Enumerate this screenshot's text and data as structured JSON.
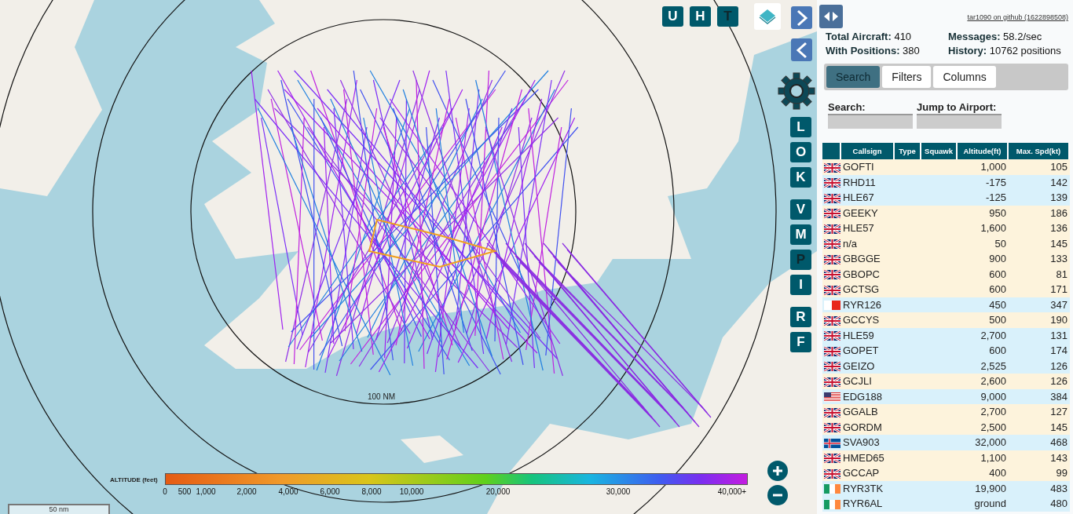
{
  "map": {
    "range_label": "100 NM",
    "scale_label": "50 nm",
    "top_buttons": [
      {
        "label": "U",
        "active": true
      },
      {
        "label": "H",
        "active": true
      },
      {
        "label": "T",
        "active": false
      }
    ],
    "side_buttons": [
      {
        "label": "L",
        "active": true
      },
      {
        "label": "O",
        "active": true
      },
      {
        "label": "K",
        "active": true
      },
      {
        "label": "V",
        "active": true
      },
      {
        "label": "M",
        "active": true
      },
      {
        "label": "P",
        "active": false
      },
      {
        "label": "I",
        "active": true
      },
      {
        "label": "R",
        "active": true
      },
      {
        "label": "F",
        "active": true
      }
    ],
    "legend": {
      "title": "ALTITUDE (feet)",
      "ticks": [
        "0",
        "500",
        "1,000",
        "2,000",
        "4,000",
        "6,000",
        "8,000",
        "10,000",
        "20,000",
        "30,000",
        "40,000+"
      ]
    }
  },
  "panel": {
    "link": "tar1090 on github (1622898508)",
    "stats": [
      "**Total Aircraft:** 410",
      "**Messages:** 58.2/sec",
      "**With Positions:** 380",
      "**History:** 10762 positions"
    ],
    "tabs": [
      {
        "label": "Search",
        "selected": true
      },
      {
        "label": "Filters",
        "selected": false
      },
      {
        "label": "Columns",
        "selected": false
      }
    ],
    "fields": [
      {
        "label": "Search:"
      },
      {
        "label": "Jump to Airport:"
      }
    ],
    "table": {
      "columns": [
        "Callsign",
        "Type",
        "Squawk",
        "Altitude(ft)",
        "Max. Spd(kt)"
      ],
      "rows": [
        {
          "kind": "uk",
          "callsign": "GOFTI",
          "altitude": "1,000",
          "speed": "105",
          "color": "#fdf3dc"
        },
        {
          "kind": "uk",
          "callsign": "RHD11",
          "altitude": "-175",
          "speed": "142",
          "color": "#d9f1fb"
        },
        {
          "kind": "uk",
          "callsign": "HLE67",
          "altitude": "-125",
          "speed": "139",
          "color": "#d9f1fb"
        },
        {
          "kind": "uk",
          "callsign": "GEEKY",
          "altitude": "950",
          "speed": "186",
          "color": "#fdf3dc"
        },
        {
          "kind": "uk",
          "callsign": "HLE57",
          "altitude": "1,600",
          "speed": "136",
          "color": "#fdf3dc"
        },
        {
          "kind": "uk",
          "callsign": "n/a",
          "altitude": "50",
          "speed": "145",
          "color": "#fdf3dc"
        },
        {
          "kind": "uk",
          "callsign": "GBGGE",
          "altitude": "900",
          "speed": "133",
          "color": "#fdf3dc"
        },
        {
          "kind": "uk",
          "callsign": "GBOPC",
          "altitude": "600",
          "speed": "81",
          "color": "#fdf3dc"
        },
        {
          "kind": "uk",
          "callsign": "GCTSG",
          "altitude": "600",
          "speed": "171",
          "color": "#fdf3dc"
        },
        {
          "kind": "malta",
          "callsign": "RYR126",
          "altitude": "450",
          "speed": "347",
          "color": "#d9f1fb"
        },
        {
          "kind": "uk",
          "callsign": "GCCYS",
          "altitude": "500",
          "speed": "190",
          "color": "#fdf3dc"
        },
        {
          "kind": "uk",
          "callsign": "HLE59",
          "altitude": "2,700",
          "speed": "131",
          "color": "#d9f1fb"
        },
        {
          "kind": "uk",
          "callsign": "GOPET",
          "altitude": "600",
          "speed": "174",
          "color": "#d9f1fb"
        },
        {
          "kind": "uk",
          "callsign": "GEIZO",
          "altitude": "2,525",
          "speed": "126",
          "color": "#d9f1fb"
        },
        {
          "kind": "uk",
          "callsign": "GCJLI",
          "altitude": "2,600",
          "speed": "126",
          "color": "#fdf3dc"
        },
        {
          "kind": "usa",
          "callsign": "EDG188",
          "altitude": "9,000",
          "speed": "384",
          "color": "#d9f1fb"
        },
        {
          "kind": "uk",
          "callsign": "GGALB",
          "altitude": "2,700",
          "speed": "127",
          "color": "#fdf3dc"
        },
        {
          "kind": "uk",
          "callsign": "GORDM",
          "altitude": "2,500",
          "speed": "145",
          "color": "#fdf3dc"
        },
        {
          "kind": "iceland",
          "callsign": "SVA903",
          "altitude": "32,000",
          "speed": "468",
          "color": "#d9f1fb"
        },
        {
          "kind": "uk",
          "callsign": "HMED65",
          "altitude": "1,100",
          "speed": "143",
          "color": "#fdf3dc"
        },
        {
          "kind": "uk",
          "callsign": "GCCAP",
          "altitude": "400",
          "speed": "99",
          "color": "#fdf3dc"
        },
        {
          "kind": "ireland",
          "callsign": "RYR3TK",
          "altitude": "19,900",
          "speed": "483",
          "color": "#d9f1fb"
        },
        {
          "kind": "ireland",
          "callsign": "RYR6AL",
          "altitude": "ground",
          "speed": "480",
          "color": "#d9f1fb"
        }
      ]
    }
  }
}
